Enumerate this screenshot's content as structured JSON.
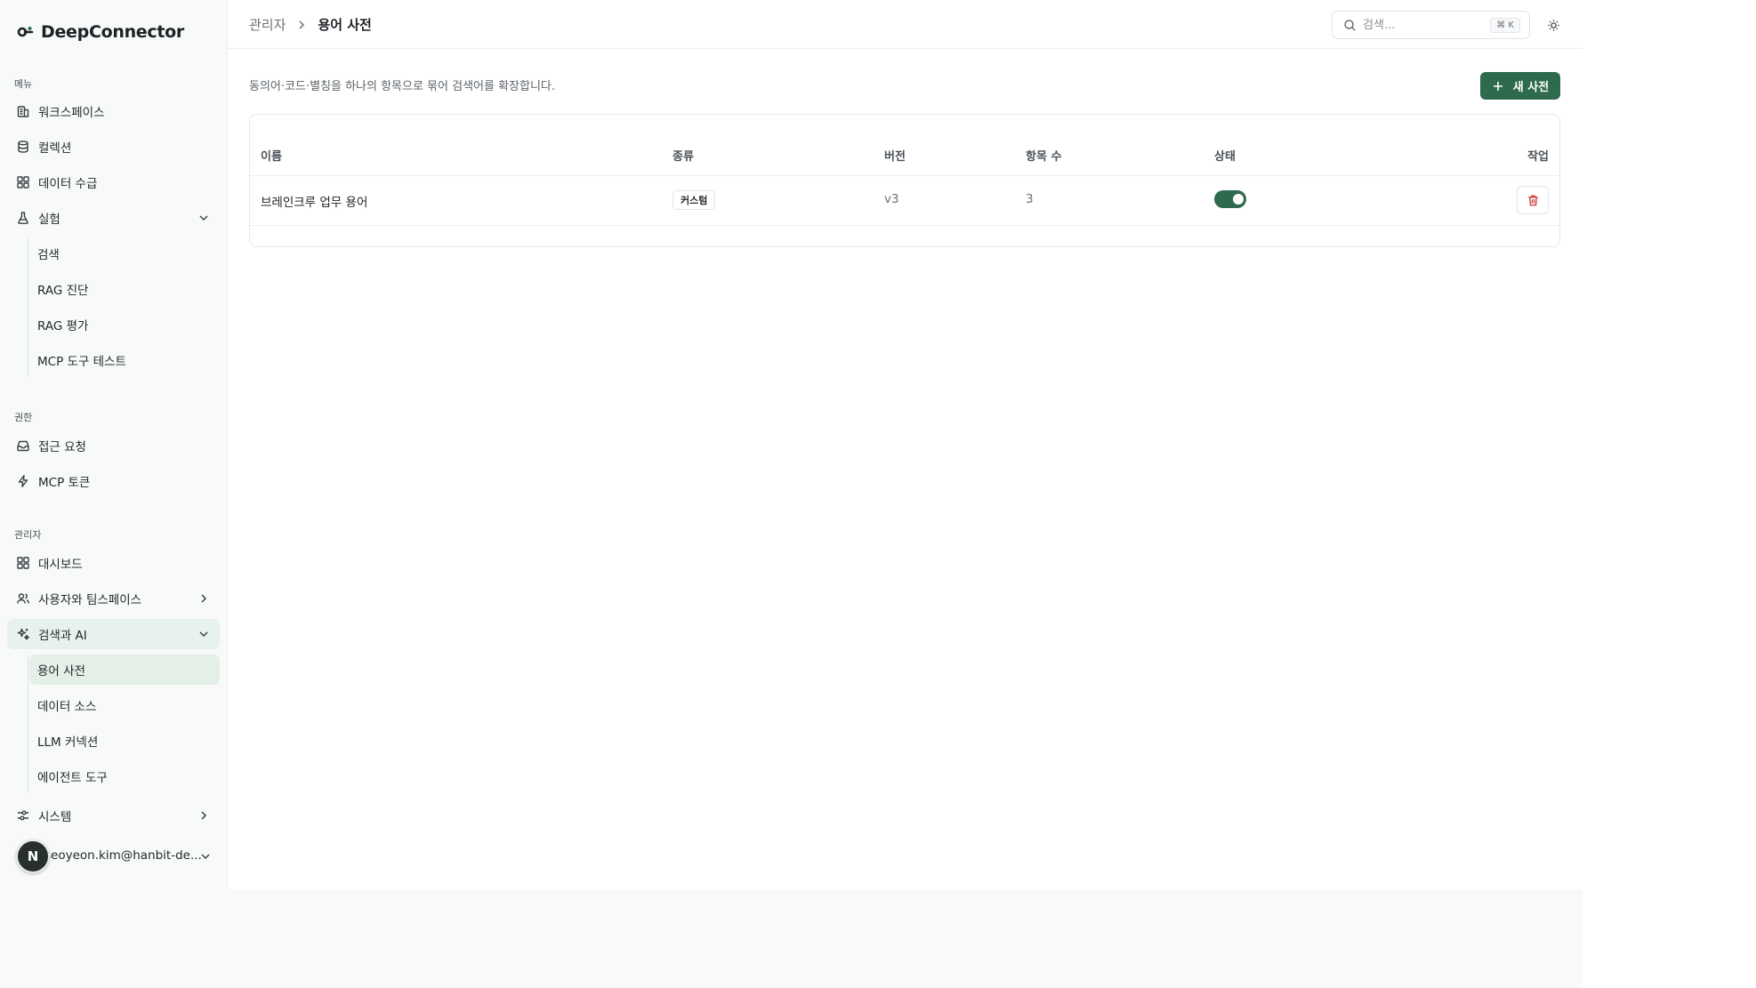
{
  "app": {
    "name": "DeepConnector"
  },
  "sidebar": {
    "menu_label": "메뉴",
    "menu_items": [
      {
        "label": "워크스페이스",
        "icon": "building-icon"
      },
      {
        "label": "컬렉션",
        "icon": "database-icon"
      },
      {
        "label": "데이터 수급",
        "icon": "grid-icon"
      },
      {
        "label": "실험",
        "icon": "flask-icon",
        "expanded": true
      }
    ],
    "experiment_children": [
      "검색",
      "RAG 진단",
      "RAG 평가",
      "MCP 도구 테스트"
    ],
    "permission_label": "권한",
    "permission_items": [
      {
        "label": "접근 요청",
        "icon": "inbox-icon"
      },
      {
        "label": "MCP 토큰",
        "icon": "lightning-icon"
      }
    ],
    "admin_label": "관리자",
    "admin_items": [
      {
        "label": "대시보드",
        "icon": "grid-icon"
      },
      {
        "label": "사용자와 팀스페이스",
        "icon": "users-icon"
      },
      {
        "label": "검색과 AI",
        "icon": "sparkle-icon",
        "expanded": true
      }
    ],
    "search_ai_children": [
      "용어 사전",
      "데이터 소스",
      "LLM 커넥션",
      "에이전트 도구"
    ],
    "active_child": "용어 사전",
    "system_item": {
      "label": "시스템",
      "icon": "sliders-icon"
    },
    "user": {
      "avatar_initial": "N",
      "email": "seoyeon.kim@hanbit-de..."
    }
  },
  "header": {
    "breadcrumb_root": "관리자",
    "breadcrumb_current": "용어 사전",
    "search_placeholder": "검색...",
    "search_shortcut": "⌘ K"
  },
  "main": {
    "description": "동의어·코드·별칭을 하나의 항목으로 묶어 검색어를 확장합니다.",
    "new_button_label": "새 사전",
    "table": {
      "columns": {
        "name": "이름",
        "type": "종류",
        "version": "버전",
        "count": "항목 수",
        "status": "상태",
        "action": "작업"
      },
      "rows": [
        {
          "name": "브레인크루 업무 용어",
          "type": "커스텀",
          "version": "v3",
          "count": "3",
          "enabled": true
        }
      ]
    }
  },
  "colors": {
    "brand": "#2e6b4d",
    "danger": "#d64545",
    "active_bg": "#e3efe7"
  }
}
